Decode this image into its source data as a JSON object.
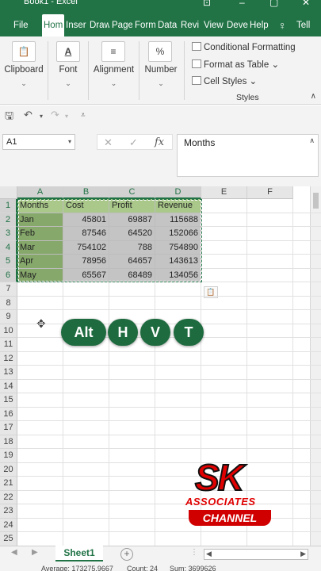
{
  "window": {
    "title": "Book1 - Excel"
  },
  "ribbon_tabs": [
    "File",
    "Home",
    "Insert",
    "Draw",
    "Page Layout",
    "Formulas",
    "Data",
    "Review",
    "View",
    "Developer",
    "Help",
    "Tell me"
  ],
  "ribbon_tab_visible": [
    "File",
    "Hom",
    "Inser",
    "Draw",
    "Page",
    "Form",
    "Data",
    "Revi",
    "View",
    "Deve",
    "Help",
    "Tell"
  ],
  "ribbon": {
    "clipboard": "Clipboard",
    "font": "Font",
    "alignment": "Alignment",
    "number": "Number",
    "conditional_formatting": "Conditional Formatting",
    "format_as_table": "Format as Table",
    "cell_styles": "Cell Styles",
    "styles_group": "Styles"
  },
  "formula_bar": {
    "name_box": "A1",
    "content": "Months"
  },
  "columns": [
    "A",
    "B",
    "C",
    "D",
    "E",
    "F"
  ],
  "rows": [
    "1",
    "2",
    "3",
    "4",
    "5",
    "6",
    "7",
    "8",
    "9",
    "10",
    "11",
    "12",
    "13",
    "14",
    "15",
    "16",
    "17",
    "18",
    "19",
    "20",
    "21",
    "22",
    "23",
    "24",
    "25"
  ],
  "table": {
    "headers": [
      "Months",
      "Cost",
      "Profit",
      "Revenue"
    ],
    "rows": [
      [
        "Jan",
        "45801",
        "69887",
        "115688"
      ],
      [
        "Feb",
        "87546",
        "64520",
        "152066"
      ],
      [
        "Mar",
        "754102",
        "788",
        "754890"
      ],
      [
        "Apr",
        "78956",
        "64657",
        "143613"
      ],
      [
        "May",
        "65567",
        "68489",
        "134056"
      ]
    ]
  },
  "shortcut_keys": [
    "Alt",
    "H",
    "V",
    "T"
  ],
  "logo": {
    "line1": "SK",
    "line2": "ASSOCIATES",
    "line3": "CHANNEL"
  },
  "sheet_tab": "Sheet1",
  "status_bar": {
    "average": "Average: 173275.9667",
    "count": "Count: 24",
    "sum": "Sum: 3699626"
  },
  "colors": {
    "excel_green": "#217346",
    "header_fill": "#a9c88a",
    "month_fill": "#86a86b",
    "number_fill": "#c4c4c4"
  }
}
